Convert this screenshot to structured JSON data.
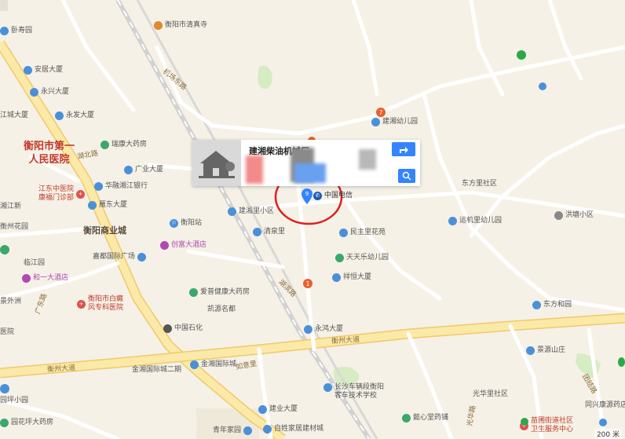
{
  "colors": {
    "land": "#f5f1e6",
    "major_road": "#fbe9a8",
    "major_road_edge": "#f0c96b",
    "minor_road": "#ffffff",
    "rail": "#c9c9c9",
    "park": "#d6ecc2",
    "highlight_circle": "#e02020",
    "marker": "#3385ff"
  },
  "card": {
    "title": "建湘柴油机械厂"
  },
  "target": {
    "label": "中国电信",
    "marker_number": "9"
  },
  "area_labels": {
    "hospital": [
      "衡阳市第一",
      "人民医院"
    ],
    "commerce": "衡阳商业城"
  },
  "roads": {
    "jichang": "机场东路",
    "hubei": "湖北路",
    "hengzhou_main": "衡州大道",
    "hengzhou_left": "衡州大道",
    "rubin": "湖滨路",
    "ruxi": "如意里",
    "guanghua": "光华路",
    "tuanjie": "团结路",
    "guangdong": "广东路"
  },
  "pois": [
    {
      "id": "p-shouyuan",
      "label": "卧寿园",
      "color": "#4a90d9"
    },
    {
      "id": "p-qingyunsi",
      "label": "衡阳市清真寺",
      "color": "#e08a2c"
    },
    {
      "id": "p-anju",
      "label": "安居大厦",
      "color": "#4a90d9"
    },
    {
      "id": "p-yongxing",
      "label": "永兴大厦",
      "color": "#4a90d9"
    },
    {
      "id": "p-yongfa",
      "label": "永发大厦",
      "color": "#4a90d9"
    },
    {
      "id": "p-jianxiang-kg",
      "label": "建湘幼儿园",
      "color": "#4a90d9"
    },
    {
      "id": "p-jiangcheng",
      "label": "江城大厦",
      "color": "#4a90d9"
    },
    {
      "id": "p-ruiyuan",
      "label": "瑞康大药房",
      "color": "#3aa86b"
    },
    {
      "id": "p-guangye",
      "label": "广业大厦",
      "color": "#4a90d9"
    },
    {
      "id": "p-huarong",
      "label": "华融湘江银行",
      "color": "#4a90d9"
    },
    {
      "id": "p-jiangzhong",
      "label": "江东中医院\n康福门诊部",
      "color": "#e05050"
    },
    {
      "id": "p-yandong",
      "label": "雁东大厦",
      "color": "#4a90d9"
    },
    {
      "id": "p-hengyang-station",
      "label": "衡阳站",
      "color": "#4a90d9"
    },
    {
      "id": "p-jianxiang-xq",
      "label": "建湘里小区",
      "color": "#4a90d9"
    },
    {
      "id": "p-qingquan",
      "label": "清泉里",
      "color": "#4a90d9"
    },
    {
      "id": "p-dongfang-sq",
      "label": "东方里社区",
      "color": "#888888"
    },
    {
      "id": "p-yunji",
      "label": "运机里幼儿园",
      "color": "#4a90d9"
    },
    {
      "id": "p-hongtang",
      "label": "洪塘小区",
      "color": "#4a90d9"
    },
    {
      "id": "p-minzhu",
      "label": "民主里花苑",
      "color": "#4a90d9"
    },
    {
      "id": "p-tiantian",
      "label": "天天乐幼儿园",
      "color": "#4a90d9"
    },
    {
      "id": "p-xiangheng",
      "label": "祥恒大厦",
      "color": "#4a90d9"
    },
    {
      "id": "p-huayuan",
      "label": "衡州花园",
      "color": "#4a90d9"
    },
    {
      "id": "p-chuangfu",
      "label": "创富大酒店",
      "color": "#b04ab0"
    },
    {
      "id": "p-jiadu",
      "label": "嘉都国际广场",
      "color": "#4a90d9"
    },
    {
      "id": "p-linjiang",
      "label": "临江园",
      "color": "#4a90d9"
    },
    {
      "id": "p-heyida",
      "label": "和一大酒店",
      "color": "#b04ab0"
    },
    {
      "id": "p-baiyi",
      "label": "衡阳市白癜\n风专科医院",
      "color": "#e05050"
    },
    {
      "id": "p-aiwei",
      "label": "爱普健康大药房",
      "color": "#3aa86b"
    },
    {
      "id": "p-kaiyuan",
      "label": "凯源名都",
      "color": "#4a90d9"
    },
    {
      "id": "p-zhongguoshihua",
      "label": "中国石化",
      "color": "#555555"
    },
    {
      "id": "p-yonghong",
      "label": "永鸿大厦",
      "color": "#4a90d9"
    },
    {
      "id": "p-dongfanghe",
      "label": "东方和园",
      "color": "#4a90d9"
    },
    {
      "id": "p-jinghua",
      "label": "景源山庄",
      "color": "#4a90d9"
    },
    {
      "id": "p-jinxiang-2",
      "label": "金湘国际城二期",
      "color": "#4a90d9"
    },
    {
      "id": "p-jinxiang",
      "label": "金湘国际城",
      "color": "#4a90d9"
    },
    {
      "id": "p-changsha",
      "label": "长沙车辆段衡阳\n客车技术学校",
      "color": "#4a90d9"
    },
    {
      "id": "p-guanghua-sq",
      "label": "光华里社区",
      "color": "#888888"
    },
    {
      "id": "p-tongxing",
      "label": "同兴康源药店",
      "color": "#4a90d9"
    },
    {
      "id": "p-jianye",
      "label": "建业大厦",
      "color": "#4a90d9"
    },
    {
      "id": "p-zixingjia",
      "label": "自姓家居建材城",
      "color": "#4a90d9"
    },
    {
      "id": "p-yixin",
      "label": "懿心堂药铺",
      "color": "#3aa86b"
    },
    {
      "id": "p-miaopu",
      "label": "苗圃街道社区\n卫生服务中心",
      "color": "#e05050"
    },
    {
      "id": "p-qingnian",
      "label": "青年家园",
      "color": "#4a90d9"
    },
    {
      "id": "p-yuanhua",
      "label": "园花坪大药房",
      "color": "#3aa86b"
    },
    {
      "id": "p-yuanping-xiaoyuan",
      "label": "园坪小园",
      "color": "#4a90d9"
    },
    {
      "id": "p-jingshi",
      "label": "景外洲",
      "color": "#4a90d9"
    },
    {
      "id": "p-yiyuan",
      "label": "医院",
      "color": "#4a90d9"
    },
    {
      "id": "p-shuiku",
      "label": "湘江新",
      "color": "#4a90d9"
    }
  ],
  "numbered_pins": [
    "7",
    "5",
    "1"
  ],
  "scale_label": "200 米"
}
